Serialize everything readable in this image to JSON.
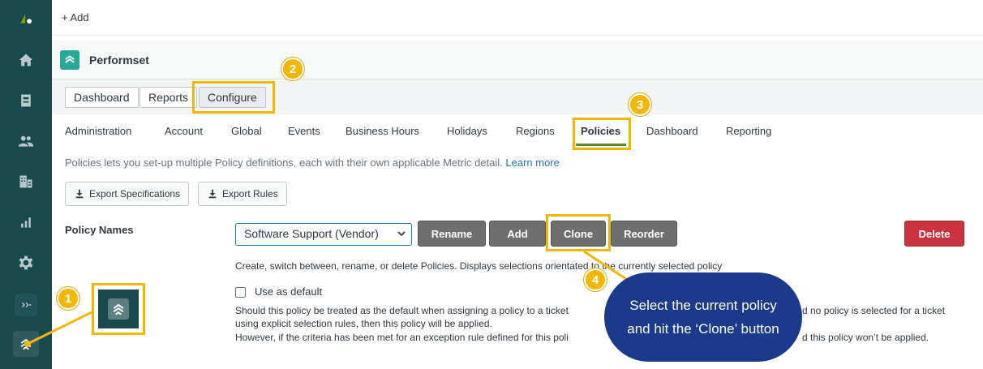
{
  "topbar": {
    "add_label": "+ Add"
  },
  "app": {
    "title": "Performset"
  },
  "primary_tabs": [
    "Dashboard",
    "Reports",
    "Configure"
  ],
  "sub_nav": [
    "Administration",
    "Account",
    "Global",
    "Events",
    "Business Hours",
    "Holidays",
    "Regions",
    "Policies",
    "Dashboard",
    "Reporting"
  ],
  "sub_nav_active": "Policies",
  "description": {
    "text": "Policies lets you set-up multiple Policy definitions, each with their own applicable Metric detail.",
    "link": "Learn more"
  },
  "export": {
    "specifications": "Export Specifications",
    "rules": "Export Rules"
  },
  "policy": {
    "label": "Policy Names",
    "selected": "Software Support (Vendor)",
    "buttons": {
      "rename": "Rename",
      "add": "Add",
      "clone": "Clone",
      "reorder": "Reorder",
      "delete": "Delete"
    },
    "help": "Create, switch between, rename, or delete Policies. Displays selections orientated to the currently selected policy",
    "default_label": "Use as default",
    "default_help_1": "Should this policy be treated as the default when assigning a policy to a ticket",
    "default_help_1b": "d no policy is selected for a ticket",
    "default_help_2": "using explicit selection rules, then this policy will be applied.",
    "default_help_3": "However, if the criteria has been met for an exception rule defined for this poli",
    "default_help_3b": "d this policy won’t be applied."
  },
  "annotations": {
    "badges": [
      "1",
      "2",
      "3",
      "4"
    ],
    "callout_line1": "Select the current policy",
    "callout_line2": "and hit the ‘Clone’ button",
    "highlight_color": "#f2b705",
    "callout_color": "#1b3a8c"
  },
  "colors": {
    "sidebar": "#17494d",
    "delete": "#cc3340",
    "button_gray": "#6f6f6f",
    "link": "#1f73b7"
  }
}
